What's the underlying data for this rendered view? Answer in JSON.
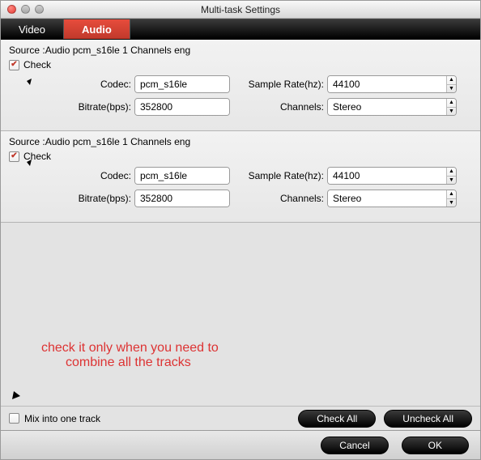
{
  "window": {
    "title": "Multi-task Settings"
  },
  "tabs": [
    {
      "label": "Video",
      "active": false
    },
    {
      "label": "Audio",
      "active": true
    }
  ],
  "sources": [
    {
      "source_line": "Source :Audio  pcm_s16le  1 Channels  eng",
      "check_label": "Check",
      "checked": true,
      "codec_label": "Codec:",
      "codec_value": "pcm_s16le",
      "bitrate_label": "Bitrate(bps):",
      "bitrate_value": "352800",
      "samplerate_label": "Sample Rate(hz):",
      "samplerate_value": "44100",
      "channels_label": "Channels:",
      "channels_value": "Stereo"
    },
    {
      "source_line": "Source :Audio  pcm_s16le  1 Channels  eng",
      "check_label": "Check",
      "checked": true,
      "codec_label": "Codec:",
      "codec_value": "pcm_s16le",
      "bitrate_label": "Bitrate(bps):",
      "bitrate_value": "352800",
      "samplerate_label": "Sample Rate(hz):",
      "samplerate_value": "44100",
      "channels_label": "Channels:",
      "channels_value": "Stereo"
    }
  ],
  "annotation": {
    "text1": "check it only when you need to",
    "text2": "combine all the tracks"
  },
  "bottom": {
    "mix_label": "Mix into one track",
    "mix_checked": false,
    "check_all": "Check All",
    "uncheck_all": "Uncheck All",
    "cancel": "Cancel",
    "ok": "OK"
  }
}
